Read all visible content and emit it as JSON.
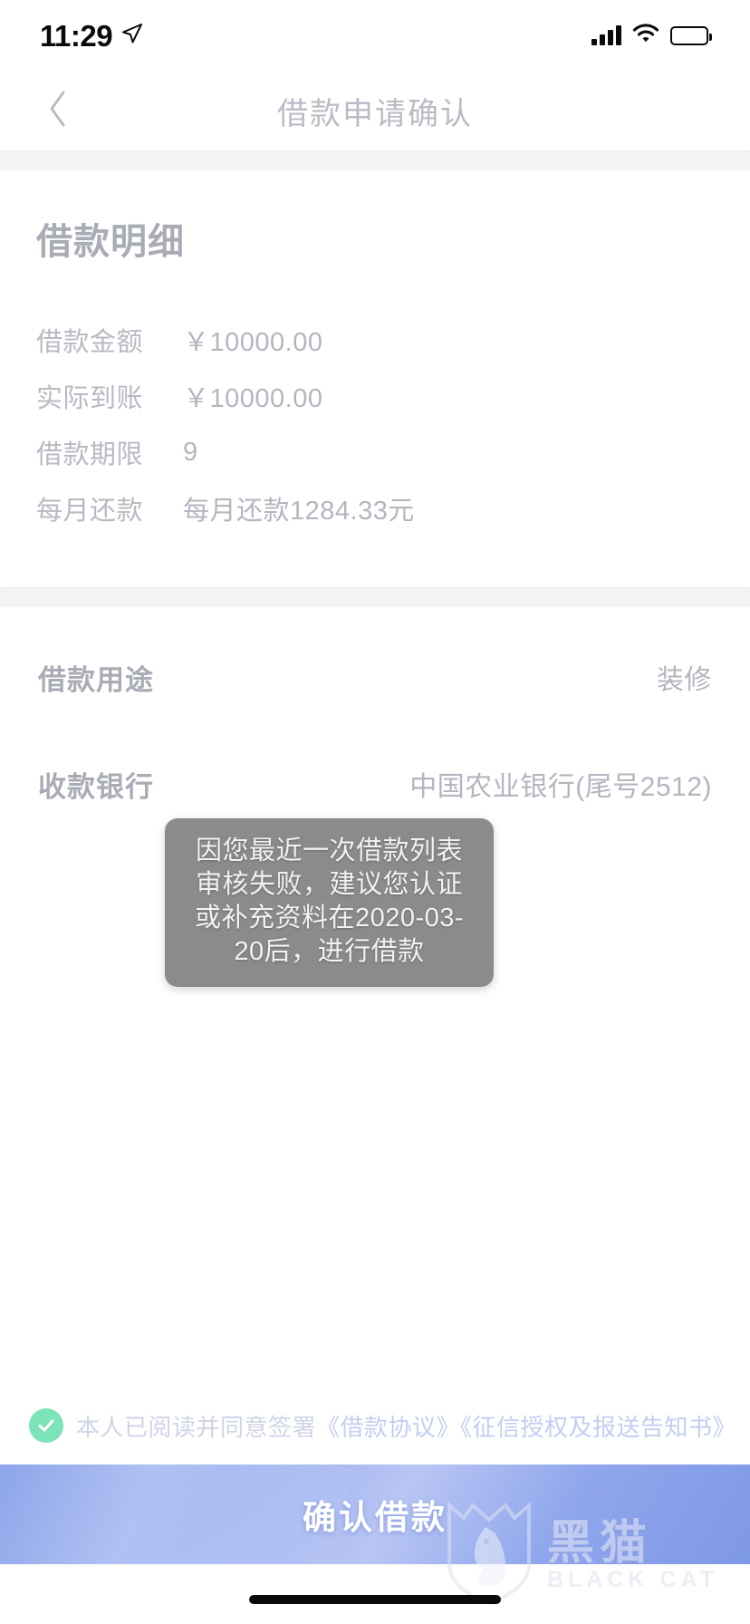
{
  "status_bar": {
    "time": "11:29",
    "location_icon": "location-arrow-icon",
    "signal_icon": "cellular-signal-icon",
    "wifi_icon": "wifi-icon",
    "battery_icon": "battery-full-icon"
  },
  "nav": {
    "back_icon": "chevron-left-icon",
    "title": "借款申请确认"
  },
  "loan_detail_card": {
    "title": "借款明细",
    "rows": [
      {
        "label": "借款金额",
        "value": "￥10000.00"
      },
      {
        "label": "实际到账",
        "value": "￥10000.00"
      },
      {
        "label": "借款期限",
        "value": "9"
      },
      {
        "label": "每月还款",
        "value": "每月还款1284.33元"
      }
    ]
  },
  "purpose_row": {
    "label": "借款用途",
    "value": "装修"
  },
  "bank_row": {
    "label": "收款银行",
    "value": "中国农业银行(尾号2512)"
  },
  "toast": {
    "message": "因您最近一次借款列表审核失败，建议您认证或补充资料在2020-03-20后，进行借款",
    "background": "#8b8b8b"
  },
  "agreement": {
    "checkbox_icon": "check-circle-icon",
    "checked": true,
    "check_color": "#7de3b8",
    "prefix": "本人已阅读并同意签署",
    "link_1": "《借款协议》",
    "link_2": "《征信授权及报送告知书》",
    "link_color": "#c3cdf2"
  },
  "confirm_button": {
    "label": "确认借款",
    "accent": "#8fa6ec"
  },
  "watermark": {
    "logo_icon": "black-cat-shield-logo",
    "cn": "黑猫",
    "en": "BLACK CAT"
  }
}
